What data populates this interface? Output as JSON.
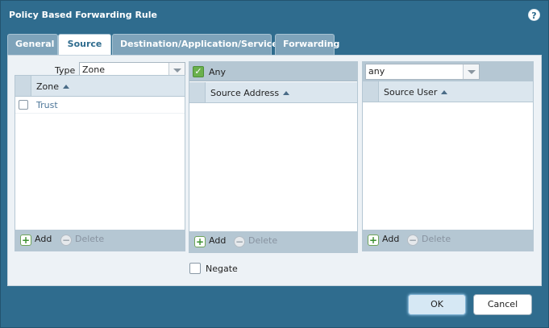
{
  "dialog": {
    "title": "Policy Based Forwarding Rule",
    "help_icon": "?"
  },
  "tabs": [
    {
      "label": "General",
      "active": false
    },
    {
      "label": "Source",
      "active": true
    },
    {
      "label": "Destination/Application/Service",
      "active": false
    },
    {
      "label": "Forwarding",
      "active": false
    }
  ],
  "zone_panel": {
    "type_label": "Type",
    "type_value": "Zone",
    "column_header": "Zone",
    "rows": [
      {
        "label": "Trust",
        "checked": false
      }
    ],
    "add_label": "Add",
    "delete_label": "Delete"
  },
  "address_panel": {
    "any_label": "Any",
    "any_checked": true,
    "column_header": "Source Address",
    "add_label": "Add",
    "delete_label": "Delete"
  },
  "user_panel": {
    "select_value": "any",
    "column_header": "Source User",
    "add_label": "Add",
    "delete_label": "Delete"
  },
  "negate": {
    "label": "Negate",
    "checked": false
  },
  "buttons": {
    "ok": "OK",
    "cancel": "Cancel"
  },
  "colors": {
    "dialog_bg": "#2f6c8e",
    "tab_active_text": "#2f6c8e",
    "panel_footer": "#b5c7d3"
  }
}
